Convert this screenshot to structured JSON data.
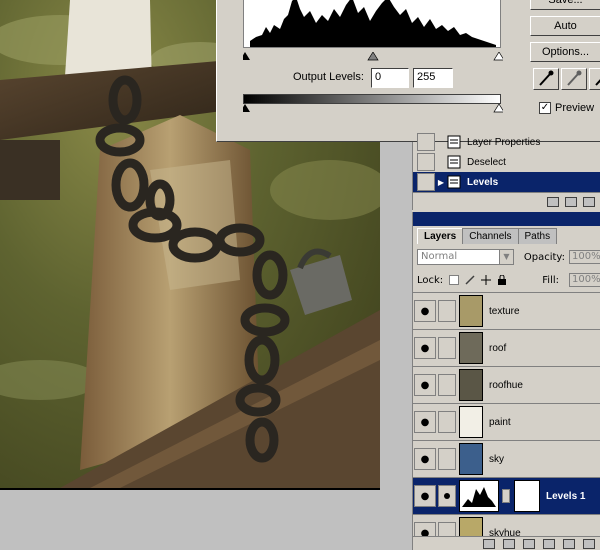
{
  "levels_dialog": {
    "save_label": "Save...",
    "auto_label": "Auto",
    "options_label": "Options...",
    "output_levels_label": "Output Levels:",
    "output_min": "0",
    "output_max": "255",
    "preview_label": "Preview",
    "preview_checked": true
  },
  "history": {
    "items": [
      {
        "label": "Layer Properties",
        "icon": "history-step-icon"
      },
      {
        "label": "Deselect",
        "icon": "history-step-icon"
      },
      {
        "label": "Levels",
        "icon": "history-step-icon",
        "selected": true
      }
    ]
  },
  "layers": {
    "tabs": [
      {
        "label": "Layers",
        "active": true
      },
      {
        "label": "Channels",
        "active": false
      },
      {
        "label": "Paths",
        "active": false
      }
    ],
    "blend_mode": "Normal",
    "opacity_label": "Opacity:",
    "opacity_value": "100%",
    "lock_label": "Lock:",
    "fill_label": "Fill:",
    "fill_value": "100%",
    "items": [
      {
        "name": "texture",
        "thumb_color": "#a89a68"
      },
      {
        "name": "roof",
        "thumb_color": "#6e6a5a"
      },
      {
        "name": "roofhue",
        "thumb_color": "#5a5646"
      },
      {
        "name": "paint",
        "thumb_color": "#f2efe6"
      },
      {
        "name": "sky",
        "thumb_color": "#3c5f8c"
      },
      {
        "name": "Levels 1",
        "selected": true,
        "adjustment": true
      },
      {
        "name": "skyhue",
        "thumb_color": "#b8a868"
      }
    ]
  },
  "colors": {
    "selection": "#0a246a",
    "panel": "#d4d0c8"
  }
}
